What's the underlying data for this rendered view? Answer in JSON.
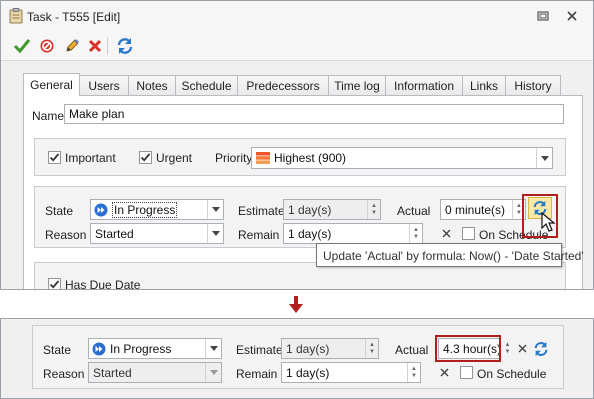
{
  "window": {
    "title": "Task - T555 [Edit]"
  },
  "toolbar": {
    "save_icon": "checkmark-icon",
    "cancel_icon": "no-entry-icon",
    "edit_icon": "pencil-icon",
    "delete_icon": "x-icon",
    "refresh_icon": "refresh-icon"
  },
  "tabs": [
    {
      "label": "General"
    },
    {
      "label": "Users"
    },
    {
      "label": "Notes"
    },
    {
      "label": "Schedule"
    },
    {
      "label": "Predecessors"
    },
    {
      "label": "Time log"
    },
    {
      "label": "Information"
    },
    {
      "label": "Links"
    },
    {
      "label": "History"
    }
  ],
  "general": {
    "name_label": "Name",
    "name_value": "Make plan",
    "important_label": "Important",
    "urgent_label": "Urgent",
    "priority_label": "Priority",
    "priority_value": "Highest (900)",
    "state_label": "State",
    "state_value": "In Progress",
    "reason_label": "Reason",
    "reason_value": "Started",
    "estimate_label": "Estimate",
    "estimate_value": "1 day(s)",
    "remain_label": "Remain",
    "remain_value": "1 day(s)",
    "actual_label": "Actual",
    "actual_value_before": "0 minute(s)",
    "actual_value_after": "4.3 hour(s)",
    "on_schedule_label": "On Schedule",
    "has_due_date_label": "Has Due Date",
    "tooltip": "Update 'Actual' by formula: Now() - 'Date Started'"
  },
  "colors": {
    "highlight": "#b01e1e",
    "arrow": "#b01e1e",
    "priority": "#e8562a"
  }
}
